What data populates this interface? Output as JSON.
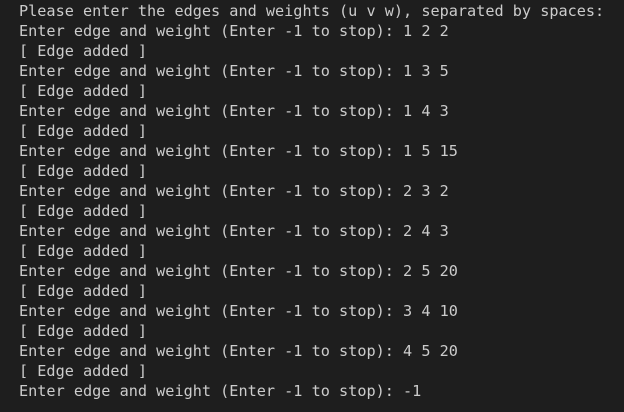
{
  "terminal": {
    "lines": [
      "Please enter the edges and weights (u v w), separated by spaces:",
      "Enter edge and weight (Enter -1 to stop): 1 2 2",
      "[ Edge added ]",
      "Enter edge and weight (Enter -1 to stop): 1 3 5",
      "[ Edge added ]",
      "Enter edge and weight (Enter -1 to stop): 1 4 3",
      "[ Edge added ]",
      "Enter edge and weight (Enter -1 to stop): 1 5 15",
      "[ Edge added ]",
      "Enter edge and weight (Enter -1 to stop): 2 3 2",
      "[ Edge added ]",
      "Enter edge and weight (Enter -1 to stop): 2 4 3",
      "[ Edge added ]",
      "Enter edge and weight (Enter -1 to stop): 2 5 20",
      "[ Edge added ]",
      "Enter edge and weight (Enter -1 to stop): 3 4 10",
      "[ Edge added ]",
      "Enter edge and weight (Enter -1 to stop): 4 5 20",
      "[ Edge added ]",
      "Enter edge and weight (Enter -1 to stop): -1"
    ],
    "colors": {
      "background": "#1e1e1e",
      "text": "#cccccc"
    }
  }
}
